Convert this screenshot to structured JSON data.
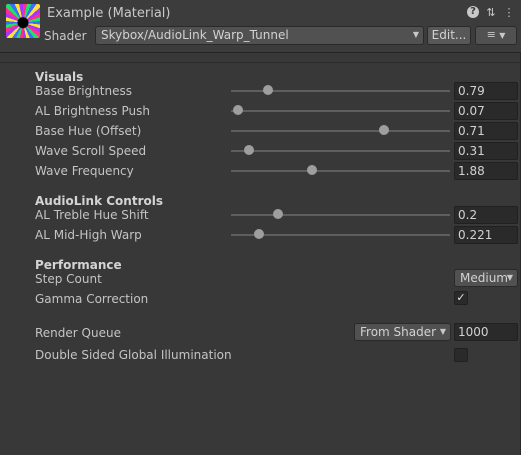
{
  "header": {
    "title": "Example (Material)",
    "shader_label": "Shader",
    "shader_value": "Skybox/AudioLink_Warp_Tunnel",
    "edit_label": "Edit...",
    "list_icon": "≡",
    "help_icon": "?",
    "settings_icon": "⇅",
    "more_icon": "⋮",
    "dropdown_icon": "▼"
  },
  "visuals": {
    "heading": "Visuals",
    "rows": [
      {
        "label": "Base Brightness",
        "value": "0.79"
      },
      {
        "label": "AL Brightness Push",
        "value": "0.07"
      },
      {
        "label": "Base Hue (Offset)",
        "value": "0.71"
      },
      {
        "label": "Wave Scroll Speed",
        "value": "0.31"
      },
      {
        "label": "Wave Frequency",
        "value": "1.88"
      }
    ]
  },
  "audiolink": {
    "heading": "AudioLink Controls",
    "rows": [
      {
        "label": "AL Treble Hue Shift",
        "value": "0.2"
      },
      {
        "label": "AL Mid-High Warp",
        "value": "0.221"
      }
    ]
  },
  "performance": {
    "heading": "Performance",
    "step_count_label": "Step Count",
    "step_count_value": "Medium",
    "gamma_label": "Gamma Correction",
    "gamma_check": "✓"
  },
  "render": {
    "queue_label": "Render Queue",
    "queue_mode": "From Shader",
    "queue_value": "1000",
    "dsgi_label": "Double Sided Global Illumination"
  }
}
